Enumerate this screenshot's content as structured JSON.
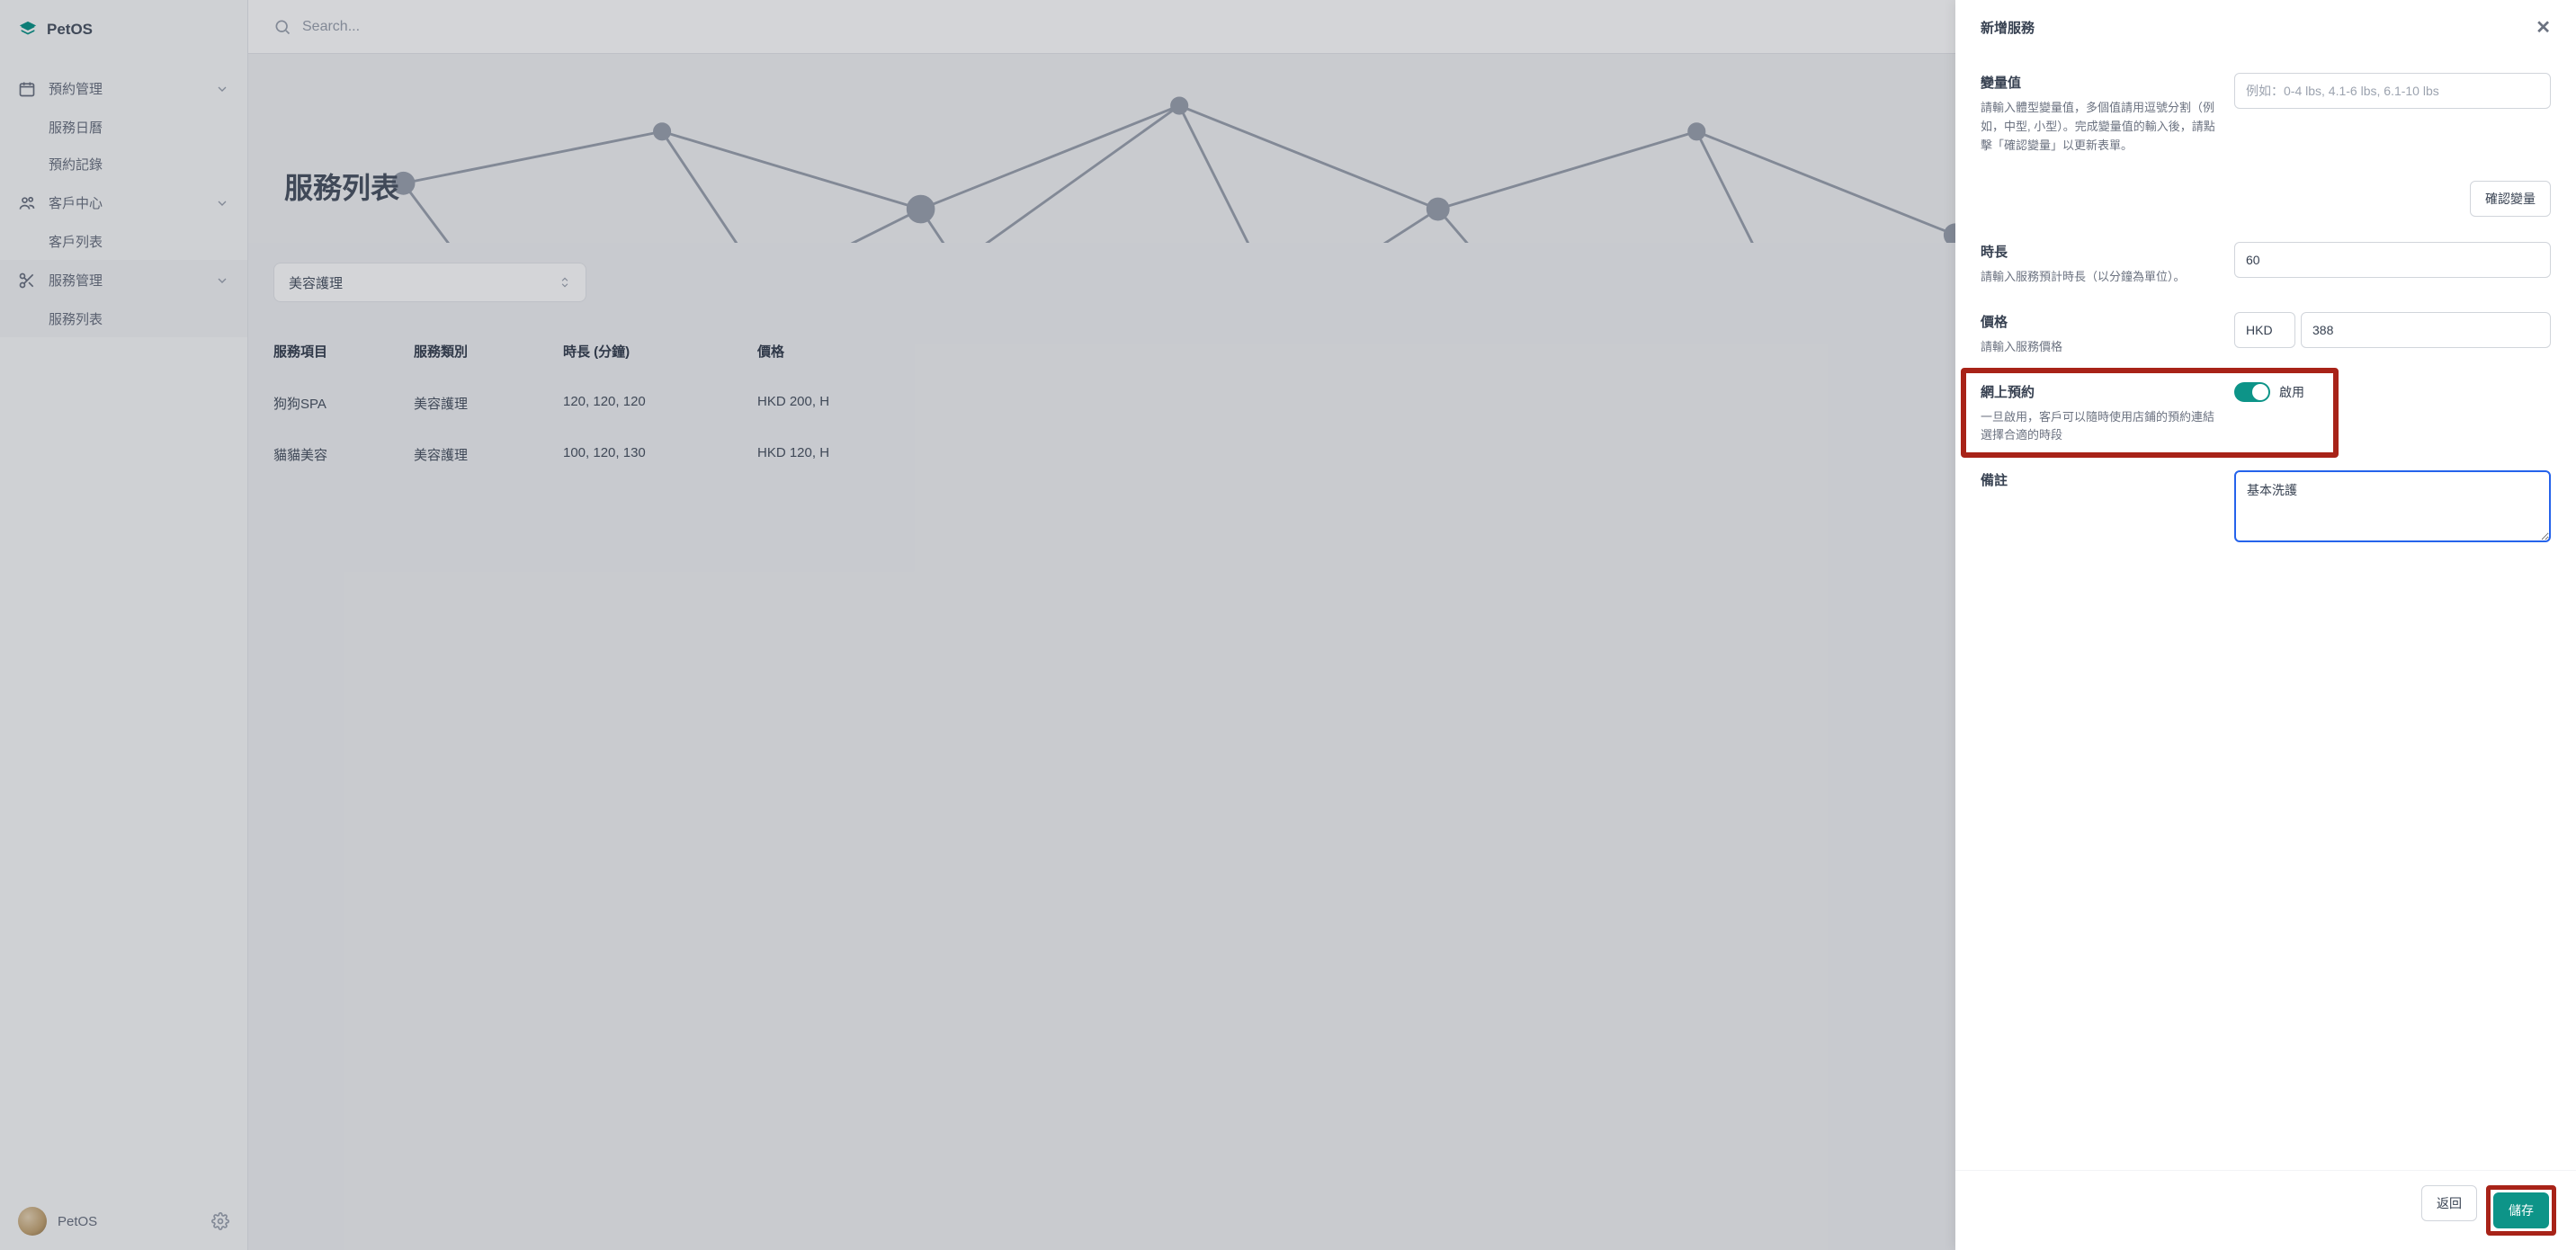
{
  "brand": "PetOS",
  "search_placeholder": "Search...",
  "sidebar": {
    "groups": [
      {
        "label": "預約管理",
        "items": [
          "服務日曆",
          "預約記錄"
        ]
      },
      {
        "label": "客戶中心",
        "items": [
          "客戶列表"
        ]
      },
      {
        "label": "服務管理",
        "items": [
          "服務列表"
        ]
      }
    ],
    "footer_label": "PetOS"
  },
  "hero_title": "服務列表",
  "category_select": "美容護理",
  "table": {
    "cols": [
      "服務項目",
      "服務類別",
      "時長 (分鐘)",
      "價格"
    ],
    "rows": [
      {
        "name": "狗狗SPA",
        "cat": "美容護理",
        "dur": "120, 120, 120",
        "price": "HKD 200, H"
      },
      {
        "name": "貓貓美容",
        "cat": "美容護理",
        "dur": "100, 120, 130",
        "price": "HKD 120, H"
      }
    ]
  },
  "drawer": {
    "title": "新增服務",
    "variable": {
      "label": "變量值",
      "desc": "請輸入體型變量值，多個值請用逗號分割（例如，中型, 小型）。完成變量值的輸入後，請點擊「確認變量」以更新表單。",
      "placeholder": "例如：0-4 lbs, 4.1-6 lbs, 6.1-10 lbs",
      "confirm": "確認變量"
    },
    "duration": {
      "label": "時長",
      "desc": "請輸入服務預計時長（以分鐘為單位）。",
      "value": "60"
    },
    "price": {
      "label": "價格",
      "desc": "請輸入服務價格",
      "currency": "HKD",
      "value": "388"
    },
    "online": {
      "label": "網上預約",
      "desc": "一旦啟用，客戶可以隨時使用店鋪的預約連結選擇合適的時段",
      "state": "啟用"
    },
    "remark": {
      "label": "備註",
      "value": "基本洗護"
    },
    "back": "返回",
    "save": "儲存"
  }
}
